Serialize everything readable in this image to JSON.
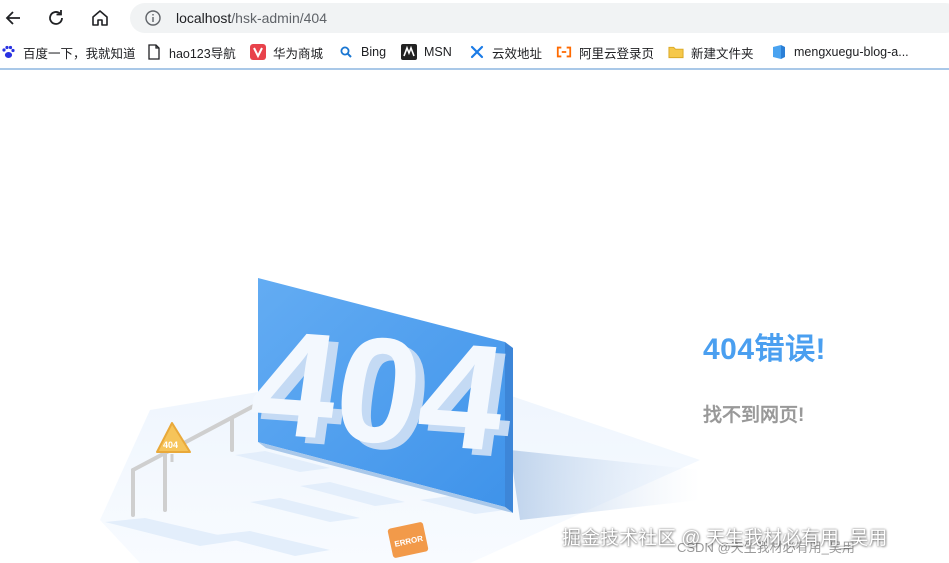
{
  "browser": {
    "url_host": "localhost",
    "url_path": "/hsk-admin/404"
  },
  "bookmarks": [
    {
      "label": "百度一下，我就知道",
      "icon": "baidu-paw-icon"
    },
    {
      "label": "hao123导航",
      "icon": "page-icon"
    },
    {
      "label": "华为商城",
      "icon": "vmall-icon"
    },
    {
      "label": "Bing",
      "icon": "bing-search-icon"
    },
    {
      "label": "MSN",
      "icon": "msn-icon"
    },
    {
      "label": "云效地址",
      "icon": "yunxiao-icon"
    },
    {
      "label": "阿里云登录页",
      "icon": "aliyun-icon"
    },
    {
      "label": "新建文件夹",
      "icon": "folder-icon"
    },
    {
      "label": "mengxuegu-blog-a...",
      "icon": "edge-tab-icon"
    }
  ],
  "page": {
    "error_title": "404错误!",
    "error_subtitle": "找不到网页!",
    "illustration_text": "404",
    "sign_small": "404",
    "sign_error": "ERROR"
  },
  "watermark": {
    "primary": "掘金技术社区 @ 天生我材必有用_吴用",
    "secondary": "CSDN @天生我材必有用_吴用"
  },
  "colors": {
    "accent": "#4a9ff0",
    "board": "#5aa8f2",
    "subtitle": "#999999"
  }
}
